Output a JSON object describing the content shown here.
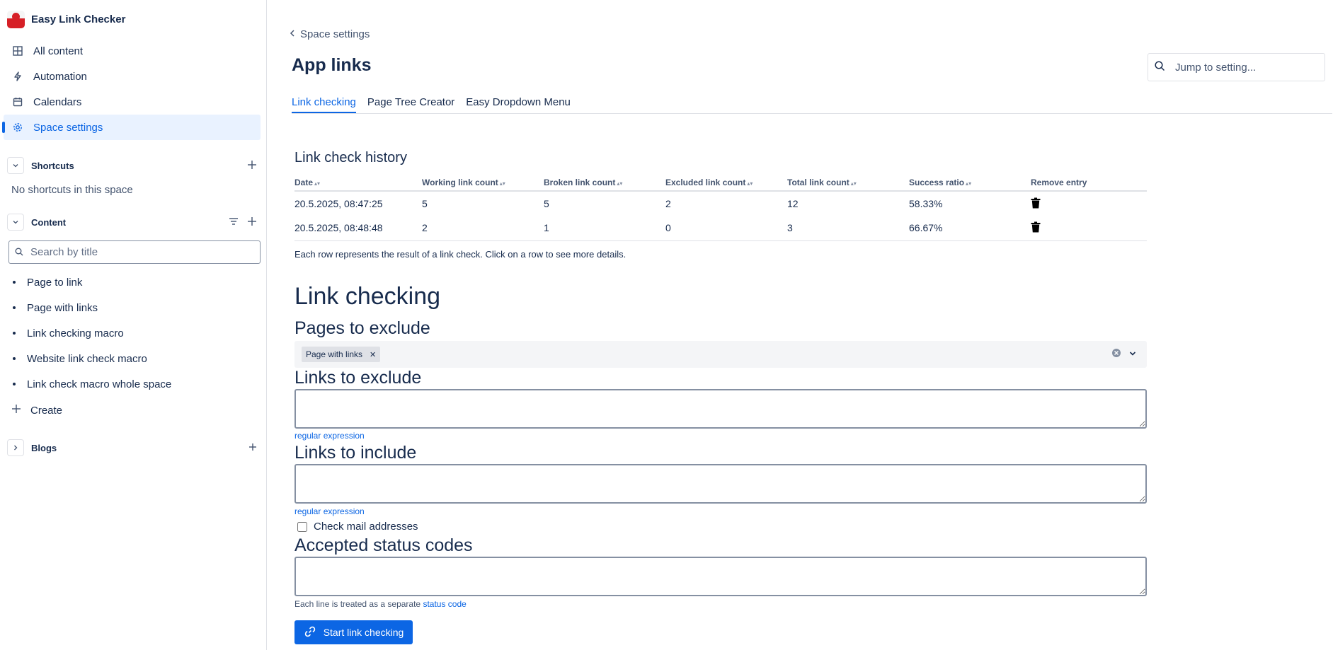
{
  "app": {
    "name": "Easy Link Checker"
  },
  "nav": [
    {
      "label": "All content",
      "icon": "grid-icon"
    },
    {
      "label": "Automation",
      "icon": "lightning-icon"
    },
    {
      "label": "Calendars",
      "icon": "calendar-icon"
    },
    {
      "label": "Space settings",
      "icon": "gear-icon",
      "active": true
    }
  ],
  "shortcuts": {
    "title": "Shortcuts",
    "empty_text": "No shortcuts in this space"
  },
  "content": {
    "title": "Content",
    "search_placeholder": "Search by title",
    "pages": [
      "Page to link",
      "Page with links",
      "Link checking macro",
      "Website link check macro",
      "Link check macro whole space"
    ],
    "create_label": "Create"
  },
  "blogs": {
    "title": "Blogs"
  },
  "main": {
    "back_label": "Space settings",
    "title": "App links",
    "jump_placeholder": "Jump to setting...",
    "tabs": [
      "Link checking",
      "Page Tree Creator",
      "Easy Dropdown Menu"
    ]
  },
  "history": {
    "title": "Link check history",
    "columns": [
      "Date",
      "Working link count",
      "Broken link count",
      "Excluded link count",
      "Total link count",
      "Success ratio",
      "Remove entry"
    ],
    "rows": [
      {
        "date": "20.5.2025, 08:47:25",
        "working": "5",
        "broken": "5",
        "excluded": "2",
        "total": "12",
        "ratio": "58.33%"
      },
      {
        "date": "20.5.2025, 08:48:48",
        "working": "2",
        "broken": "1",
        "excluded": "0",
        "total": "3",
        "ratio": "66.67%"
      }
    ],
    "note": "Each row represents the result of a link check. Click on a row to see more details."
  },
  "form": {
    "heading": "Link checking",
    "pages_to_exclude": {
      "label": "Pages to exclude",
      "chips": [
        "Page with links"
      ]
    },
    "links_to_exclude": {
      "label": "Links to exclude",
      "helper": "regular expression"
    },
    "links_to_include": {
      "label": "Links to include",
      "helper": "regular expression"
    },
    "check_mail": {
      "label": "Check mail addresses"
    },
    "status_codes": {
      "label": "Accepted status codes",
      "helper_prefix": "Each line is treated as a separate",
      "helper_link": "status code"
    },
    "start_button": "Start link checking"
  },
  "colors": {
    "accent": "#0c66e4",
    "active_bg": "#e9f2ff",
    "text": "#172b4d"
  }
}
